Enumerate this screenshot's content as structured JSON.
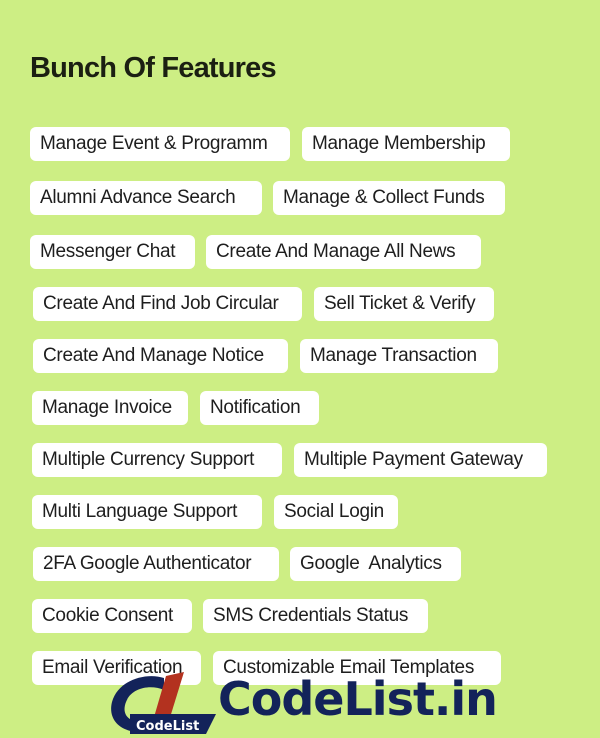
{
  "section": {
    "title": "Bunch Of Features"
  },
  "features": [
    "Manage Event & Programm",
    "Manage Membership",
    "Alumni Advance Search",
    "Manage & Collect Funds",
    "Messenger Chat",
    "Create And Manage All News",
    "Create And Find Job Circular",
    "Sell Ticket & Verify",
    "Create And Manage Notice",
    "Manage Transaction",
    "Manage Invoice",
    "Notification",
    "Multiple Currency Support",
    "Multiple Payment Gateway",
    "Multi Language Support",
    "Social Login",
    "2FA Google Authenticator",
    "Google  Analytics",
    "Cookie Consent",
    "SMS Credentials Status",
    "Email Verification",
    "Customizable Email Templates"
  ],
  "watermark": {
    "mark_label": "CodeList",
    "text": "CodeList.in"
  },
  "colors": {
    "background": "#cdee84",
    "chip": "#ffffff",
    "logo_navy": "#13235a",
    "logo_red": "#b3321f"
  }
}
